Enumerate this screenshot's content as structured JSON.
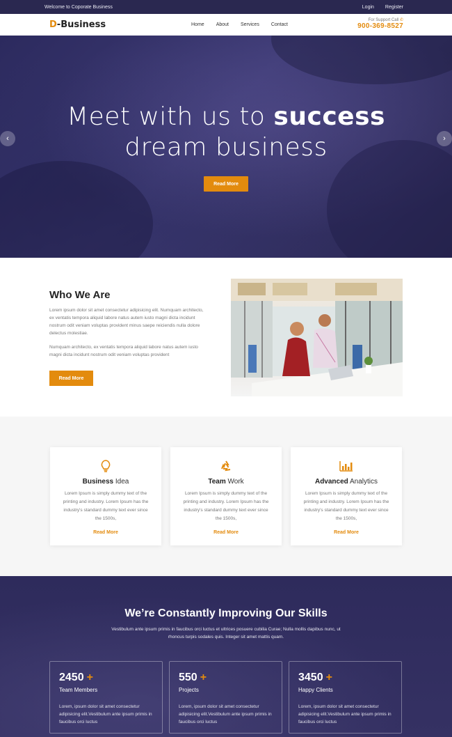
{
  "topbar": {
    "welcome": "Welcome to Coporate Business",
    "login": "Login",
    "register": "Register"
  },
  "header": {
    "logo_d": "D",
    "logo_rest": "-Business",
    "nav": [
      "Home",
      "About",
      "Services",
      "Contact"
    ],
    "support_label": "For Support Call",
    "support_phone": "900-369-8527"
  },
  "hero": {
    "line1_light": "Meet with us to",
    "line1_bold": "success",
    "line2": "dream business",
    "button": "Read More",
    "prev": "‹",
    "next": "›"
  },
  "about": {
    "title": "Who We Are",
    "para1": "Lorem ipsum dolor sit amet consectetur adipisicing elit. Numquam architecto, ex ventatis tempora aliquid labore natus autem iusto magni dicta incidunt nostrum odit veniam voluptas provident minus saepe reiciendis nulla dolore delectus molestiae.",
    "para2": "Numquam architecto, ex ventatis tempora aliquid labore natus autem iusto magni dicta incidunt nostrum odit veniam voluptas provident",
    "button": "Read More"
  },
  "features": [
    {
      "title_bold": "Business",
      "title_rest": " Idea",
      "text": "Lorem Ipsum is simply dummy text of the printing and industry. Lorem Ipsum has the industry's standard dummy text ever since the 1500s,",
      "link": "Read More",
      "icon": "lightbulb-icon"
    },
    {
      "title_bold": "Team",
      "title_rest": " Work",
      "text": "Lorem Ipsum is simply dummy text of the printing and industry. Lorem Ipsum has the industry's standard dummy text ever since the 1500s,",
      "link": "Read More",
      "icon": "recycle-icon"
    },
    {
      "title_bold": "Advanced",
      "title_rest": " Analytics",
      "text": "Lorem Ipsum is simply dummy text of the printing and industry. Lorem Ipsum has the industry's standard dummy text ever since the 1500s,",
      "link": "Read More",
      "icon": "bar-chart-icon"
    }
  ],
  "skills": {
    "title": "We’re Constantly Improving Our Skills",
    "lead": "Vestibulum ante ipsum primis in faucibus orci luctus et ultrices posuere cubilia Curae; Nulla mollis dapibus nunc, ut rhoncus turpis sodales quis. Integer sit amet mattis quam.",
    "stats": [
      {
        "number": "2450",
        "plus": "+",
        "label": "Team Members",
        "desc": "Lorem, ipsum dolor sit amet consectetur adipisicing elit.Vestibulum ante ipsum primis in faucibus orci luctus"
      },
      {
        "number": "550",
        "plus": "+",
        "label": "Projects",
        "desc": "Lorem, ipsum dolor sit amet consectetur adipisicing elit.Vestibulum ante ipsum primis in faucibus orci luctus"
      },
      {
        "number": "3450",
        "plus": "+",
        "label": "Happy Clients",
        "desc": "Lorem, ipsum dolor sit amet consectetur adipisicing elit.Vestibulum ante ipsum primis in faucibus orci luctus"
      }
    ]
  },
  "colors": {
    "accent": "#e38b0e",
    "dark": "#2e2b5c"
  }
}
